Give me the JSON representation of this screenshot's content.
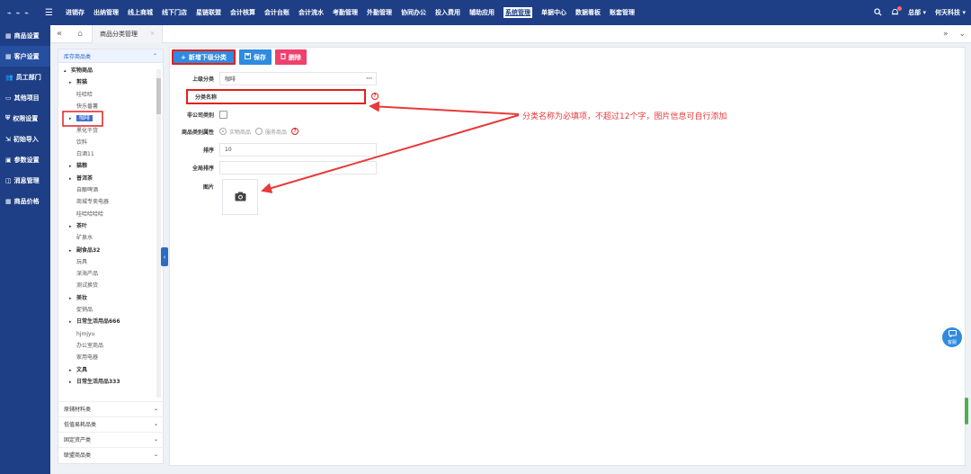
{
  "topbar": {
    "logo_text": "⌁ ⌁ ⌁",
    "nav": [
      "进销存",
      "出纳管理",
      "线上商城",
      "线下门店",
      "星链联盟",
      "会计核算",
      "会计台账",
      "会计流水",
      "考勤管理",
      "外勤管理",
      "协同办公",
      "投入费用",
      "辅助应用",
      "系统管理",
      "单据中心",
      "数据看板",
      "账套管理"
    ],
    "active_nav": "系统管理",
    "user": "总部 ▾",
    "company": "何天科技 ▾"
  },
  "sidebar": {
    "items": [
      "商品设置",
      "客户设置",
      "员工部门",
      "其他项目",
      "权限设置",
      "初始导入",
      "参数设置",
      "消息管理",
      "商品价格"
    ]
  },
  "tabbar": {
    "tab_label": "商品分类管理",
    "tab_close": "✕"
  },
  "leftpanel": {
    "header": "库存商品类",
    "tree": [
      {
        "label": "实物商品",
        "level": 0,
        "toggle": "▴",
        "bold": true
      },
      {
        "label": "剪猫",
        "level": 1,
        "toggle": "▸",
        "bold": true
      },
      {
        "label": "哇哈哈",
        "level": 2
      },
      {
        "label": "快乐番薯",
        "level": 2
      },
      {
        "label": "咖啡",
        "level": 1,
        "toggle": "▸",
        "selected": true
      },
      {
        "label": "黑化干货",
        "level": 2
      },
      {
        "label": "饮料",
        "level": 2
      },
      {
        "label": "白酒11",
        "level": 2
      },
      {
        "label": "猫粮",
        "level": 1,
        "toggle": "▸",
        "bold": true
      },
      {
        "label": "普洱茶",
        "level": 1,
        "toggle": "▸",
        "bold": true
      },
      {
        "label": "自酿啤酒",
        "level": 2
      },
      {
        "label": "商城专卖电器",
        "level": 2
      },
      {
        "label": "哇哈哈哈哈",
        "level": 2
      },
      {
        "label": "茶叶",
        "level": 1,
        "toggle": "▸",
        "bold": true
      },
      {
        "label": "矿泉水",
        "level": 2
      },
      {
        "label": "副食品32",
        "level": 1,
        "toggle": "▸",
        "bold": true
      },
      {
        "label": "玩具",
        "level": 2
      },
      {
        "label": "深海产品",
        "level": 2
      },
      {
        "label": "测试换货",
        "level": 2
      },
      {
        "label": "美妆",
        "level": 1,
        "toggle": "▸",
        "bold": true
      },
      {
        "label": "促销品",
        "level": 2
      },
      {
        "label": "日常生活用品666",
        "level": 1,
        "toggle": "▸",
        "bold": true
      },
      {
        "label": "hjmjyu",
        "level": 2
      },
      {
        "label": "办公室商品",
        "level": 2
      },
      {
        "label": "家用电器",
        "level": 2
      },
      {
        "label": "文具",
        "level": 1,
        "toggle": "▸",
        "bold": true
      },
      {
        "label": "日常生活用品333",
        "level": 1,
        "toggle": "▸",
        "bold": true
      }
    ],
    "categories": [
      "原辅材料类",
      "低值易耗品类",
      "固定资产类",
      "联盟商品类"
    ]
  },
  "toolbar": {
    "add_label": "新增下级分类",
    "save_label": "保存",
    "delete_label": "删除"
  },
  "form": {
    "parent_label": "上级分类",
    "parent_value": "咖啡",
    "parent_more": "···",
    "name_label": "分类名称",
    "name_value": "",
    "help_mark": "?",
    "non_company_label": "非公司类别",
    "attr_label": "商品类别属性",
    "attr_options": [
      "实物商品",
      "服务商品"
    ],
    "sort_label": "排序",
    "sort_value": "10",
    "global_sort_label": "全局排序",
    "global_sort_value": "",
    "image_label": "图片"
  },
  "annotation": {
    "text": "分类名称为必填项，不超过12个字，图片信息可自行添加",
    "color": "#e83a3a"
  },
  "service": {
    "label": "客服"
  },
  "colors": {
    "topbar": "#1e3f86",
    "primary": "#2e8be0",
    "danger": "#f0406c",
    "highlight_box": "#e02020"
  }
}
